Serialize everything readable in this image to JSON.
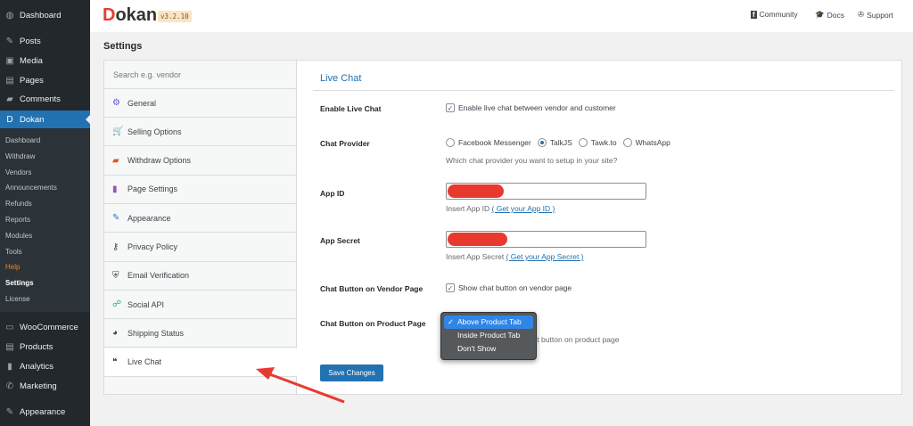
{
  "sidebar": {
    "items": [
      {
        "label": "Dashboard",
        "icon": "◍"
      },
      {
        "label": "Posts",
        "icon": "✎"
      },
      {
        "label": "Media",
        "icon": "▣"
      },
      {
        "label": "Pages",
        "icon": "▤"
      },
      {
        "label": "Comments",
        "icon": "▰"
      },
      {
        "label": "Dokan",
        "icon": "D"
      },
      {
        "label": "WooCommerce",
        "icon": "▭"
      },
      {
        "label": "Products",
        "icon": "▤"
      },
      {
        "label": "Analytics",
        "icon": "▮"
      },
      {
        "label": "Marketing",
        "icon": "✆"
      },
      {
        "label": "Appearance",
        "icon": "✎"
      }
    ],
    "submenu": [
      "Dashboard",
      "Withdraw",
      "Vendors",
      "Announcements",
      "Refunds",
      "Reports",
      "Modules",
      "Tools",
      "Help",
      "Settings",
      "License"
    ]
  },
  "header": {
    "logo": "Dokan",
    "version": "v3.2.10",
    "links": [
      {
        "label": "Community",
        "icon": "f"
      },
      {
        "label": "Docs",
        "icon": "🎓"
      },
      {
        "label": "Support",
        "icon": "✇"
      }
    ]
  },
  "page_title": "Settings",
  "nav": {
    "search_placeholder": "Search e.g. vendor",
    "items": [
      {
        "label": "General",
        "icon": "⚙",
        "color": "#5b5bd6"
      },
      {
        "label": "Selling Options",
        "icon": "🛒",
        "color": "#1e9be8"
      },
      {
        "label": "Withdraw Options",
        "icon": "▰",
        "color": "#e2541f"
      },
      {
        "label": "Page Settings",
        "icon": "▮",
        "color": "#9b4fc4"
      },
      {
        "label": "Appearance",
        "icon": "✎",
        "color": "#2a7bd0"
      },
      {
        "label": "Privacy Policy",
        "icon": "⚷",
        "color": "#444"
      },
      {
        "label": "Email Verification",
        "icon": "⛨",
        "color": "#444"
      },
      {
        "label": "Social API",
        "icon": "☍",
        "color": "#2bb673"
      },
      {
        "label": "Shipping Status",
        "icon": "◕",
        "color": "#444"
      },
      {
        "label": "Live Chat",
        "icon": "❝",
        "color": "#333"
      }
    ]
  },
  "main": {
    "section_title": "Live Chat",
    "enable": {
      "label": "Enable Live Chat",
      "text": "Enable live chat between vendor and customer"
    },
    "provider": {
      "label": "Chat Provider",
      "options": [
        "Facebook Messenger",
        "TalkJS",
        "Tawk.to",
        "WhatsApp"
      ],
      "selected": "TalkJS",
      "help": "Which chat provider you want to setup in your site?"
    },
    "app_id": {
      "label": "App ID",
      "help": "Insert App ID",
      "link": "( Get your App ID )"
    },
    "app_secret": {
      "label": "App Secret",
      "help": "Insert App Secret",
      "link": "( Get your App Secret )"
    },
    "vendor_btn": {
      "label": "Chat Button on Vendor Page",
      "text": "Show chat button on vendor page"
    },
    "product_btn": {
      "label": "Chat Button on Product Page",
      "options": [
        "Above Product Tab",
        "Inside Product Tab",
        "Don't Show"
      ],
      "selected": "Above Product Tab",
      "help": "Show chat button on product page"
    },
    "save": "Save Changes"
  }
}
